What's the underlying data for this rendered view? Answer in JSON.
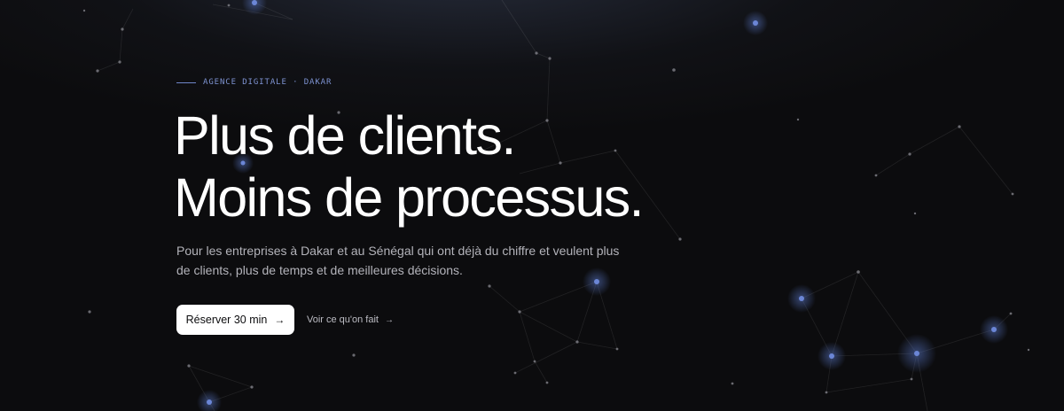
{
  "hero": {
    "eyebrow": "AGENCE DIGITALE · DAKAR",
    "headline_line1": "Plus de clients.",
    "headline_line2": "Moins de processus.",
    "subtext": "Pour les entreprises à Dakar et au Sénégal qui ont déjà du chiffre et veulent plus de clients, plus de temps et de meilleures décisions.",
    "primary_cta": "Réserver 30 min",
    "primary_cta_icon": "→",
    "secondary_cta": "Voir ce qu'on fait",
    "secondary_cta_icon": "→"
  },
  "colors": {
    "background": "#0c0c0e",
    "accent": "#7e93d2",
    "text": "#ffffff",
    "muted_text": "#b3b3ba",
    "button_bg": "#ffffff",
    "glow_node": "#5a78c8"
  }
}
